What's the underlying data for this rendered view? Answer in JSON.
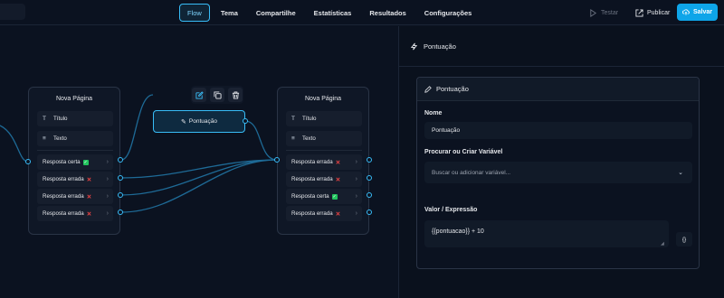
{
  "topbar": {
    "tabs": [
      "Flow",
      "Tema",
      "Compartilhe",
      "Estatísticas",
      "Resultados",
      "Configurações"
    ],
    "active_tab": "Flow",
    "test_label": "Testar",
    "publish_label": "Publicar",
    "save_label": "Salvar",
    "accent": "#0ea5e9"
  },
  "canvas": {
    "node1": {
      "title": "Nova Página",
      "items": [
        {
          "icon": "T",
          "label": "Título"
        },
        {
          "icon": "≡",
          "label": "Texto"
        }
      ],
      "answers": [
        {
          "label": "Resposta certa",
          "mark": "ok"
        },
        {
          "label": "Resposta errada",
          "mark": "bad"
        },
        {
          "label": "Resposta errada",
          "mark": "bad"
        },
        {
          "label": "Resposta errada",
          "mark": "bad"
        }
      ]
    },
    "pontuacao_node": {
      "label": "Pontuação"
    },
    "node2": {
      "title": "Nova Página",
      "items": [
        {
          "icon": "T",
          "label": "Título"
        },
        {
          "icon": "≡",
          "label": "Texto"
        }
      ],
      "answers": [
        {
          "label": "Resposta errada",
          "mark": "bad"
        },
        {
          "label": "Resposta errada",
          "mark": "bad"
        },
        {
          "label": "Resposta certa",
          "mark": "ok"
        },
        {
          "label": "Resposta errada",
          "mark": "bad"
        }
      ]
    }
  },
  "panel": {
    "header": "Pontuação",
    "card_title": "Pontuação",
    "name_label": "Nome",
    "name_value": "Pontuação",
    "variable_label": "Procurar ou Criar Variável",
    "variable_placeholder": "Buscar ou adicionar variável...",
    "expr_label": "Valor / Expressão",
    "expr_value": "{{pontuacao}} + 10",
    "brace_button": "{}"
  }
}
